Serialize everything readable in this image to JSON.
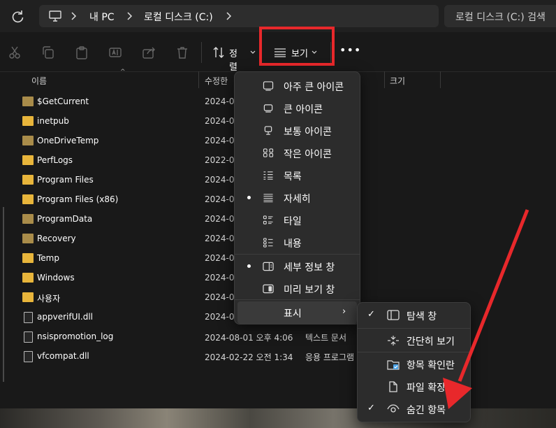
{
  "address": {
    "crumbs": [
      "내 PC",
      "로컬 디스크 (C:)"
    ],
    "search_placeholder": "로컬 디스크 (C:) 검색"
  },
  "toolbar": {
    "sort_label": "정렬",
    "view_label": "보기"
  },
  "columns": [
    "이름",
    "수정한",
    "크기"
  ],
  "files": [
    {
      "name": "$GetCurrent",
      "date": "2024-0",
      "type": "",
      "kind": "folder-dim"
    },
    {
      "name": "inetpub",
      "date": "2024-0",
      "type": "",
      "kind": "folder"
    },
    {
      "name": "OneDriveTemp",
      "date": "2024-0",
      "type": "",
      "kind": "folder-dim"
    },
    {
      "name": "PerfLogs",
      "date": "2022-0",
      "type": "",
      "kind": "folder"
    },
    {
      "name": "Program Files",
      "date": "2024-0",
      "type": "",
      "kind": "folder"
    },
    {
      "name": "Program Files (x86)",
      "date": "2024-0",
      "type": "",
      "kind": "folder"
    },
    {
      "name": "ProgramData",
      "date": "2024-0",
      "type": "",
      "kind": "folder-dim"
    },
    {
      "name": "Recovery",
      "date": "2024-0",
      "type": "",
      "kind": "folder-dim"
    },
    {
      "name": "Temp",
      "date": "2024-0",
      "type": "",
      "kind": "folder"
    },
    {
      "name": "Windows",
      "date": "2024-0",
      "type": "",
      "kind": "folder"
    },
    {
      "name": "사용자",
      "date": "2024-0",
      "type": "",
      "kind": "folder"
    },
    {
      "name": "appverifUI.dll",
      "date": "2024-0",
      "type": "",
      "kind": "file"
    },
    {
      "name": "nsispromotion_log",
      "date": "2024-08-01 오후 4:06",
      "type": "텍스트 문서",
      "kind": "file"
    },
    {
      "name": "vfcompat.dll",
      "date": "2024-02-22 오전 1:34",
      "type": "응용 프로그램",
      "kind": "file"
    }
  ],
  "view_menu": {
    "items": [
      {
        "label": "아주 큰 아이콘",
        "icon": "monitor-xl-icon",
        "selected": false
      },
      {
        "label": "큰 아이콘",
        "icon": "monitor-lg-icon",
        "selected": false
      },
      {
        "label": "보통 아이콘",
        "icon": "monitor-md-icon",
        "selected": false
      },
      {
        "label": "작은 아이콘",
        "icon": "small-icons-icon",
        "selected": false
      },
      {
        "label": "목록",
        "icon": "list-icon",
        "selected": false
      },
      {
        "label": "자세히",
        "icon": "details-icon",
        "selected": true
      },
      {
        "label": "타일",
        "icon": "tiles-icon",
        "selected": false
      },
      {
        "label": "내용",
        "icon": "content-icon",
        "selected": false
      }
    ],
    "panes": [
      {
        "label": "세부 정보 창",
        "icon": "details-pane-icon",
        "selected": true
      },
      {
        "label": "미리 보기 창",
        "icon": "preview-pane-icon",
        "selected": false
      }
    ],
    "show_label": "표시"
  },
  "show_menu": {
    "items": [
      {
        "label": "탐색 창",
        "icon": "navigation-pane-icon",
        "checked": true
      },
      {
        "label": "간단히 보기",
        "icon": "compact-view-icon",
        "checked": false
      },
      {
        "label": "항목 확인란",
        "icon": "item-checkbox-icon",
        "checked": false
      },
      {
        "label": "파일 확장",
        "icon": "file-extension-icon",
        "checked": false
      },
      {
        "label": "숨긴 항목",
        "icon": "hidden-items-icon",
        "checked": true
      }
    ]
  },
  "colors": {
    "highlight": "#e8282b",
    "folder": "#e8b53b"
  }
}
